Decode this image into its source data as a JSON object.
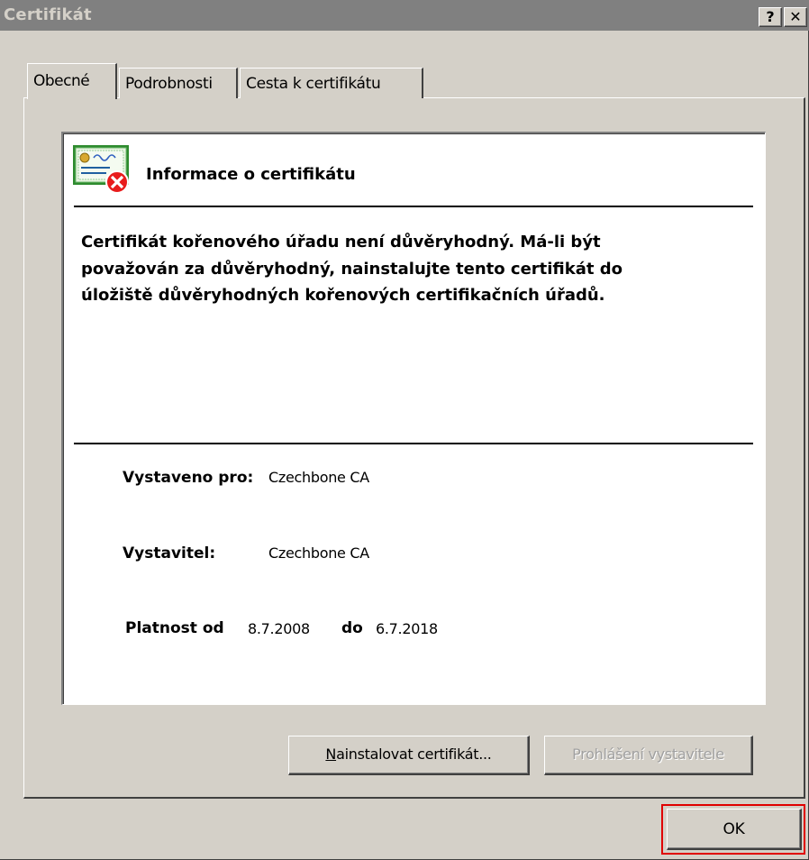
{
  "window": {
    "title": "Certifikát",
    "help_button": "?",
    "close_button": "✕"
  },
  "tabs": [
    {
      "label": "Obecné",
      "active": true
    },
    {
      "label": "Podrobnosti",
      "active": false
    },
    {
      "label": "Cesta k certifikátu",
      "active": false
    }
  ],
  "info": {
    "icon": "certificate-error-icon",
    "title": "Informace o certifikátu",
    "warning": "Certifikát kořenového úřadu není důvěryhodný. Má-li být považován za důvěryhodný, nainstalujte tento certifikát do úložiště důvěryhodných kořenových certifikačních úřadů."
  },
  "fields": {
    "issued_to_label": "Vystaveno pro:",
    "issued_to_value": "Czechbone CA",
    "issuer_label": "Vystavitel:",
    "issuer_value": "Czechbone CA",
    "valid_from_label": "Platnost od",
    "valid_from_value": "8.7.2008",
    "valid_to_label": "do",
    "valid_to_value": "6.7.2018"
  },
  "buttons": {
    "install_mnemonic": "N",
    "install_rest": "ainstalovat certifikát...",
    "statement": "Prohlášení vystavitele",
    "ok": "OK"
  },
  "colors": {
    "dialog_bg": "#d4d0c8",
    "titlebar_bg": "#808080",
    "highlight_border": "#e00000"
  }
}
